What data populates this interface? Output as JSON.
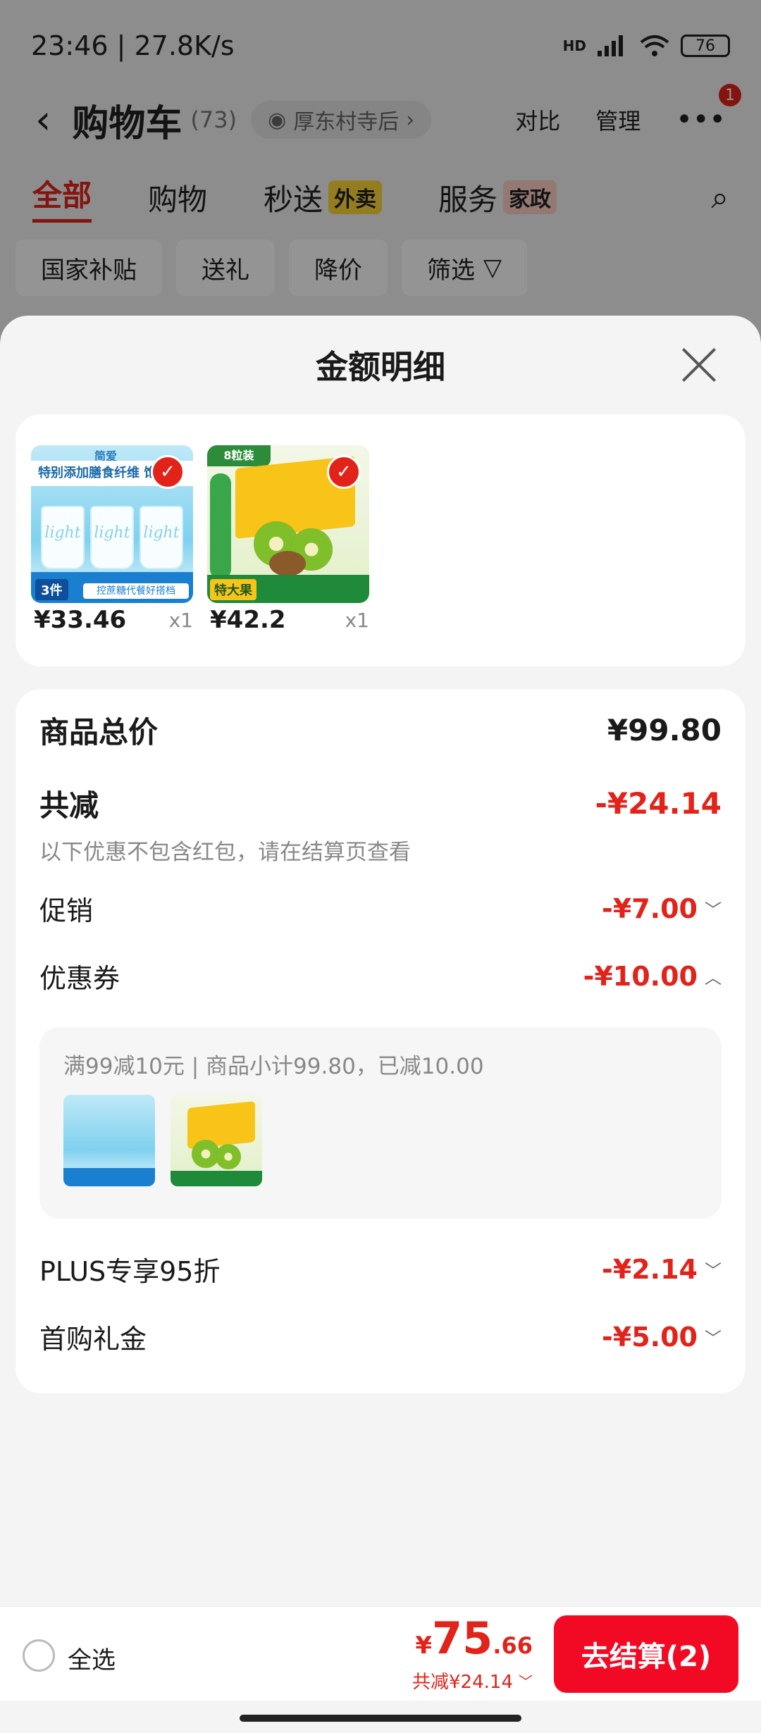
{
  "status": {
    "time": "23:46 | 27.8K/s",
    "net": "HD",
    "battery": "76"
  },
  "header": {
    "title": "购物车",
    "count": "(73)",
    "location": "厚东村寺后",
    "compare": "对比",
    "manage": "管理",
    "badge": "1"
  },
  "tabs": [
    {
      "label": "全部"
    },
    {
      "label": "购物"
    },
    {
      "label": "秒送",
      "tag": "外卖"
    },
    {
      "label": "服务",
      "tag": "家政"
    }
  ],
  "filters": [
    "国家补贴",
    "送礼",
    "降价",
    "筛选"
  ],
  "sheet": {
    "title": "金额明细"
  },
  "products": [
    {
      "price": "¥33.46",
      "qty": "x1",
      "brand_label": "简爱",
      "banner": "特别添加膳食纤维 饱腹",
      "cup_text": "light",
      "count_tag": "3件",
      "promo": "控蔗糖代餐好搭档"
    },
    {
      "price": "¥42.2",
      "qty": "x1",
      "pack_label": "8粒装",
      "big_tag": "特大果"
    }
  ],
  "summary": {
    "total_label": "商品总价",
    "total_value": "¥99.80",
    "discount_label": "共减",
    "discount_value": "-¥24.14",
    "note": "以下优惠不包含红包，请在结算页查看",
    "promo_label": "促销",
    "promo_value": "-¥7.00",
    "coupon_label": "优惠券",
    "coupon_value": "-¥10.00",
    "coupon_detail": "满99减10元 | 商品小计99.80，已减10.00",
    "plus_label": "PLUS专享95折",
    "plus_value": "-¥2.14",
    "gift_label": "首购礼金",
    "gift_value": "-¥5.00"
  },
  "bottom": {
    "select_all": "全选",
    "currency": "¥",
    "total_int": "75",
    "total_dec": ".66",
    "saved": "共减¥24.14",
    "checkout": "去结算(2)"
  },
  "colors": {
    "accent": "#e2231a",
    "checkout": "#f20a24"
  }
}
